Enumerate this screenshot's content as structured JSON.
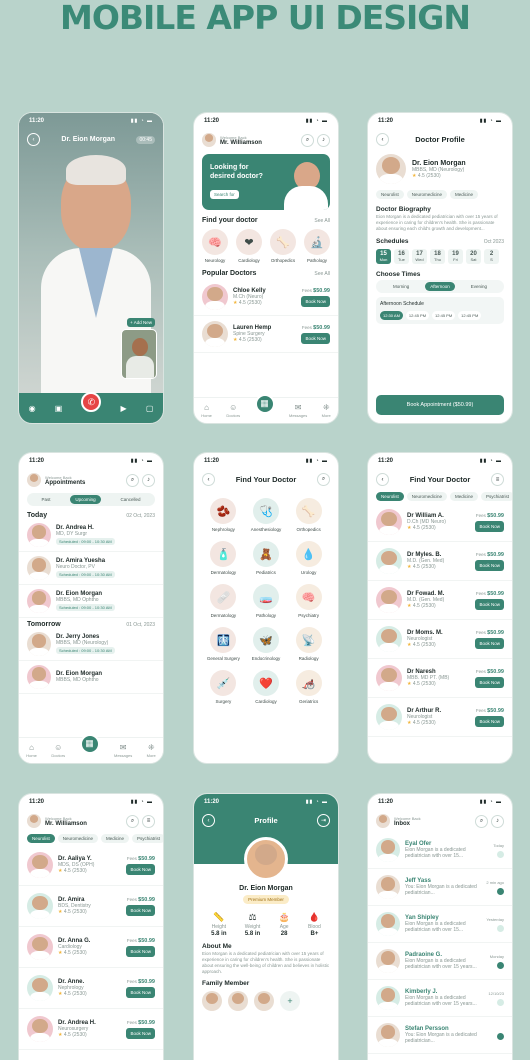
{
  "header": {
    "title": "MOBILE APP UI DESIGN"
  },
  "time": "11:20",
  "call": {
    "doctor": "Dr. Eion Morgan",
    "timer": "00:45",
    "add_new": "+ Add New"
  },
  "home": {
    "welcome": "Welcome Back",
    "user": "Mr. Williamson",
    "banner": "Looking for desired doctor?",
    "banner_btn": "Search for",
    "find": "Find your doctor",
    "see_all": "See All",
    "categories": [
      "Neurology",
      "Cardiology",
      "Orthopedics",
      "Pathology"
    ],
    "popular": "Popular Doctors",
    "doctors": [
      {
        "name": "Chloe Kelly",
        "spec": "M.Ch (Neuro)",
        "rating": "4.5 (2530)",
        "fee": "$50.99"
      },
      {
        "name": "Lauren Hemp",
        "spec": "Spine Surgery",
        "rating": "4.5 (2530)",
        "fee": "$50.99"
      }
    ],
    "fee_label": "Fees",
    "book": "Book Now",
    "nav": [
      "Home",
      "Doctors",
      "Messages",
      "More"
    ]
  },
  "profile": {
    "title": "Doctor Profile",
    "name": "Dr. Eion Morgan",
    "spec": "MBBS, MD (Neurology)",
    "rating": "4.5 (2530)",
    "tags": [
      "Neurolist",
      "Neuromedicine",
      "Medicine"
    ],
    "bio_title": "Doctor Biography",
    "bio": "Eion Morgan is a dedicated pediatrician with over 15 years of experience in caring for children's health. She is passionate about ensuring each child's growth and development...",
    "sched": "Schedules",
    "month": "Oct 2023",
    "days": [
      {
        "d": "15",
        "w": "Mon"
      },
      {
        "d": "16",
        "w": "Tue"
      },
      {
        "d": "17",
        "w": "Wed"
      },
      {
        "d": "18",
        "w": "Thu"
      },
      {
        "d": "19",
        "w": "Fri"
      },
      {
        "d": "20",
        "w": "Sat"
      },
      {
        "d": "2",
        "w": "S"
      }
    ],
    "choose": "Choose Times",
    "periods": [
      "Morning",
      "Afternoon",
      "Evening"
    ],
    "aft": "Afternoon Schedule",
    "slots": [
      "12:30 AM",
      "12:45 PM",
      "12:45 PM",
      "12:45 PM"
    ],
    "book": "Book Appointment ($50.99)"
  },
  "appts": {
    "welcome": "Welcome Back",
    "title": "Appointments",
    "tabs": [
      "Past",
      "Upcoming",
      "Cancelled"
    ],
    "today": "Today",
    "date1": "02 Oct, 2023",
    "tomorrow": "Tomorrow",
    "date2": "01 Oct, 2023",
    "items": [
      {
        "name": "Dr. Andrea H.",
        "spec": "MD, DY Surgr",
        "time": "Scheduled : 09:00 - 10:30 AM"
      },
      {
        "name": "Dr. Amira Yuesha",
        "spec": "Neuro Doctor, PV",
        "time": "Scheduled : 09:00 - 10:30 AM"
      },
      {
        "name": "Dr. Eion Morgan",
        "spec": "MBBS, MD Ophtho",
        "time": "Scheduled : 09:00 - 10:30 AM"
      },
      {
        "name": "Dr. Jerry Jones",
        "spec": "MBBS, MD (Neurology)",
        "time": "Scheduled : 09:00 - 10:30 AM"
      },
      {
        "name": "Dr. Eion Morgan",
        "spec": "MBBS, MD Ophtho",
        "time": ""
      }
    ],
    "nav": [
      "Home",
      "Doctors",
      "Messages",
      "More"
    ]
  },
  "find1": {
    "title": "Find Your Doctor",
    "items": [
      "Nephrology",
      "Anesthesiology",
      "Orthopedics",
      "Dermatology",
      "Pediatrics",
      "Urology",
      "Dermatology",
      "Pathology",
      "Psychiatry",
      "General Surgery",
      "Endocrinology",
      "Radiology",
      "Surgery",
      "Cardiology",
      "Geriatrics"
    ],
    "icons": [
      "🫘",
      "🩺",
      "🦴",
      "🧴",
      "🧸",
      "💧",
      "🩹",
      "🧫",
      "🧠",
      "🩻",
      "🦋",
      "📡",
      "💉",
      "❤️",
      "🦽"
    ]
  },
  "find2": {
    "title": "Find Your Doctor",
    "chips": [
      "Neurolist",
      "Neuromedicine",
      "Medicine",
      "Psychiatrist"
    ],
    "fee_label": "Fees",
    "book": "Book Now",
    "doctors": [
      {
        "name": "Dr William A.",
        "spec": "D.Ch (MD Neuro)",
        "rating": "4.5 (2530)",
        "fee": "$50.99"
      },
      {
        "name": "Dr Myles. B.",
        "spec": "M.D. (Gen. Med)",
        "rating": "4.5 (2530)",
        "fee": "$50.99"
      },
      {
        "name": "Dr Fowad. M.",
        "spec": "M.D. (Gen. Med)",
        "rating": "4.5 (2530)",
        "fee": "$50.99"
      },
      {
        "name": "Dr Moms. M.",
        "spec": "Neurologist",
        "rating": "4.5 (2530)",
        "fee": "$50.99"
      },
      {
        "name": "Dr Naresh",
        "spec": "MBB. MD PT. (MB)",
        "rating": "4.5 (2530)",
        "fee": "$50.99"
      },
      {
        "name": "Dr Arthur R.",
        "spec": "Neurologist",
        "rating": "4.5 (2530)",
        "fee": "$50.99"
      }
    ]
  },
  "list3": {
    "welcome": "Welcome Back",
    "user": "Mr. Williamson",
    "chips": [
      "Neurolist",
      "Neuromedicine",
      "Medicine",
      "Psychiatrist"
    ],
    "fee_label": "Fees",
    "book": "Book Now",
    "doctors": [
      {
        "name": "Dr. Aaliya Y.",
        "spec": "MDS, DS (OPH)",
        "rating": "4.5 (2530)",
        "fee": "$50.99"
      },
      {
        "name": "Dr. Amira",
        "spec": "BDS, Dentistry",
        "rating": "4.5 (2530)",
        "fee": "$50.99"
      },
      {
        "name": "Dr. Anna G.",
        "spec": "Cardiology",
        "rating": "4.5 (2530)",
        "fee": "$50.99"
      },
      {
        "name": "Dr. Anne.",
        "spec": "Nephrology",
        "rating": "4.5 (2530)",
        "fee": "$50.99"
      },
      {
        "name": "Dr. Andrea H.",
        "spec": "Neurosurgery",
        "rating": "4.5 (2530)",
        "fee": "$50.99"
      }
    ]
  },
  "prof": {
    "title": "Profile",
    "name": "Dr. Eion Morgan",
    "badge": "Premium Member",
    "stats": [
      {
        "l": "Height",
        "v": "5.8 in"
      },
      {
        "l": "Weight",
        "v": "5.8 in"
      },
      {
        "l": "Age",
        "v": "28"
      },
      {
        "l": "Blood",
        "v": "B+"
      }
    ],
    "about": "About Me",
    "about_text": "Eion Morgan is a dedicated pediatrician with over 15 years of experience in caring for children's health. She is passionate about ensuring the well-being of children and believes in holistic approach.",
    "family": "Family Member"
  },
  "inbox": {
    "welcome": "Welcome Back",
    "title": "Inbox",
    "msgs": [
      {
        "name": "Eyal Ofer",
        "text": "Eion Morgan is a dedicated pediatrician with over 15...",
        "time": "Today"
      },
      {
        "name": "Jeff Yass",
        "text": "You: Eion Morgan is a dedicated pediatrician...",
        "time": "2 min ago"
      },
      {
        "name": "Yan Shipley",
        "text": "Eion Morgan is a dedicated pediatrician with over 15...",
        "time": "Yesterday"
      },
      {
        "name": "Padraoine G.",
        "text": "Eion Morgan is a dedicated pediatrician with over 15 years...",
        "time": "Monday"
      },
      {
        "name": "Kimberly J.",
        "text": "Eion Morgan is a dedicated pediatrician with over 15 years...",
        "time": "12/10/23"
      },
      {
        "name": "Stefan Persson",
        "text": "You: Eion Morgan is a dedicated pediatrician...",
        "time": ""
      }
    ]
  }
}
